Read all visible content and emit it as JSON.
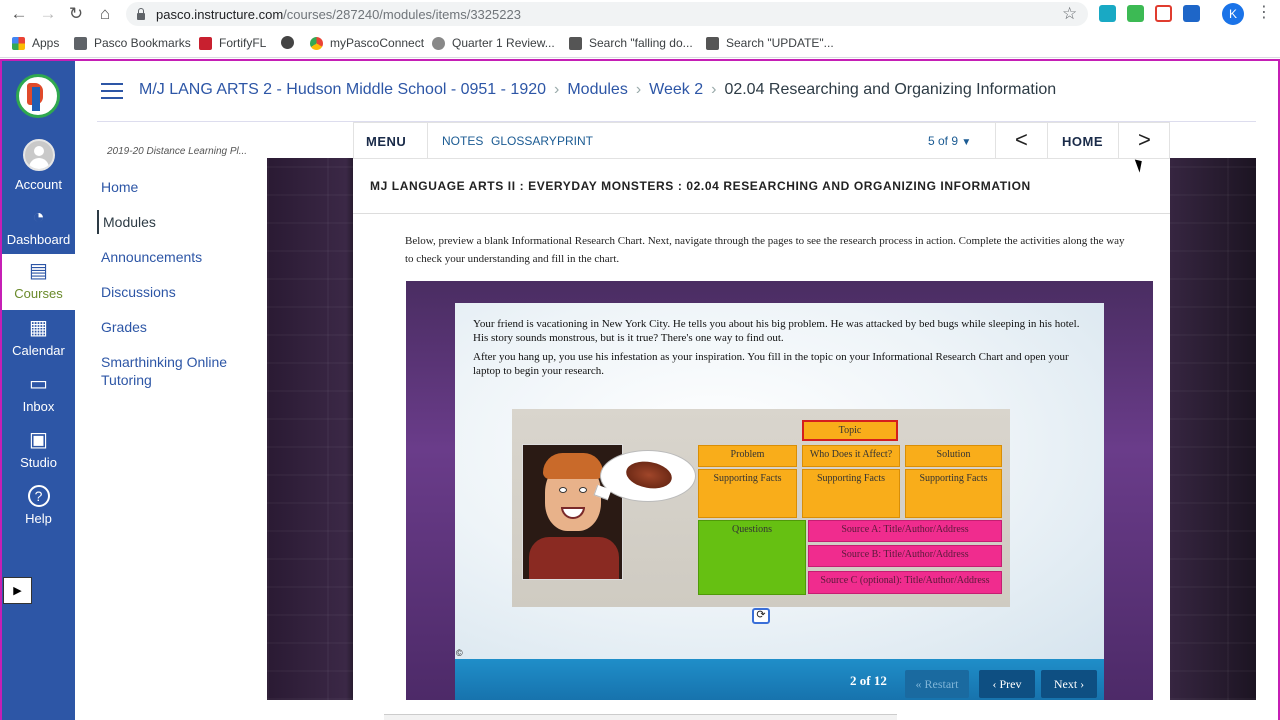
{
  "browser": {
    "url_host": "pasco.instructure.com",
    "url_path": "/courses/287240/modules/items/3325223",
    "profile_initial": "K",
    "bookmarks": [
      "Apps",
      "Pasco Bookmarks",
      "FortifyFL",
      "myPascoConnect",
      "Quarter 1 Review...",
      "Search \"falling do...",
      "Search \"UPDATE\"..."
    ]
  },
  "global_nav": {
    "items": [
      {
        "label": "Account",
        "icon": "account-icon"
      },
      {
        "label": "Dashboard",
        "icon": "dashboard-icon"
      },
      {
        "label": "Courses",
        "icon": "courses-icon"
      },
      {
        "label": "Calendar",
        "icon": "calendar-icon"
      },
      {
        "label": "Inbox",
        "icon": "inbox-icon"
      },
      {
        "label": "Studio",
        "icon": "studio-icon"
      },
      {
        "label": "Help",
        "icon": "help-icon"
      }
    ],
    "active": "Courses",
    "expander_glyph": "▶"
  },
  "breadcrumb": {
    "course": "M/J LANG ARTS 2 - Hudson Middle School - 0951 - 1920",
    "modules": "Modules",
    "week": "Week 2",
    "current": "02.04 Researching and Organizing Information"
  },
  "course_nav": {
    "term": "2019-20 Distance Learning Pl...",
    "items": [
      "Home",
      "Modules",
      "Announcements",
      "Discussions",
      "Grades",
      "Smarthinking Online Tutoring"
    ],
    "selected": "Modules"
  },
  "toolbar": {
    "menu": "MENU",
    "notes": "NOTES",
    "glossary": "GLOSSARY",
    "print": "PRINT",
    "page_counter": "5 of 9",
    "prev_glyph": "<",
    "home": "HOME",
    "next_glyph": ">"
  },
  "lesson": {
    "title_prefix": "MJ LANGUAGE ARTS II",
    "title_mid": "EVERYDAY MONSTERS",
    "title_end": "02.04 RESEARCHING AND ORGANIZING INFORMATION",
    "intro": "Below, preview a blank Informational Research Chart. Next, navigate through the pages to see the research process in action. Complete the activities along the way to check your understanding and fill in the chart."
  },
  "activity": {
    "para1": "Your friend is vacationing in New York City. He tells you about his big problem. He was attacked by bed bugs while sleeping in his hotel. His story sounds monstrous, but is it true? There's one way to find out.",
    "para2": "After you hang up, you use his infestation as your inspiration. You fill in the topic on your Informational Research Chart and open your laptop to begin your research.",
    "chart": {
      "topic": "Topic",
      "problem": "Problem",
      "who": "Who Does it Affect?",
      "solution": "Solution",
      "supporting": "Supporting Facts",
      "questions": "Questions",
      "source_a": "Source A: Title/Author/Address",
      "source_b": "Source B: Title/Author/Address",
      "source_c": "Source C (optional): Title/Author/Address"
    },
    "copyright": "©",
    "page_count": "2 of 12",
    "restart": "« Restart",
    "prev": "‹ Prev",
    "next": "Next ›"
  }
}
